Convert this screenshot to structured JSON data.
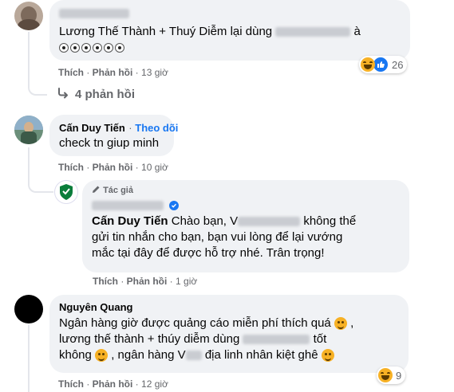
{
  "comment1": {
    "text_line1_a": "Lương Thế Thành + Thuý Diễm lại dùng",
    "text_line1_b": "à",
    "eyes": "👀👀👀👀👀",
    "like_label": "Thích",
    "reply_label": "Phản hồi",
    "time": "13 giờ",
    "reactions": "26"
  },
  "replies_link": "4 phản hồi",
  "comment2": {
    "author": "Cấn Duy Tiến",
    "follow": "Theo dõi",
    "text": "check tn giup minh",
    "like_label": "Thích",
    "reply_label": "Phản hồi",
    "time": "10 giờ"
  },
  "reply": {
    "author_badge": "Tác giả",
    "mention": "Cấn Duy Tiến",
    "text_a": "Chào bạn, V",
    "text_b": "không thể",
    "line2": "gửi tin nhắn cho bạn, bạn vui lòng để lại vướng",
    "line3": "mắc tại đây để được hỗ trợ nhé. Trân trọng!",
    "like_label": "Thích",
    "reply_label": "Phản hồi",
    "time": "1 giờ"
  },
  "comment3": {
    "author": "Nguyên Quang",
    "line1": "Ngân hàng giờ được quảng cáo miễn phí thích quá",
    "line2_a": "lương thế thành + thúy diễm dùng",
    "line2_b": "tốt",
    "line3_a": "không",
    "line3_b": ", ngân hàng V",
    "line3_c": "địa linh nhân kiệt ghê",
    "like_label": "Thích",
    "reply_label": "Phản hồi",
    "time": "12 giờ",
    "reactions": "9"
  },
  "colors": {
    "bubble": "#f0f2f5",
    "link": "#1877f2",
    "meta": "#65676b"
  }
}
